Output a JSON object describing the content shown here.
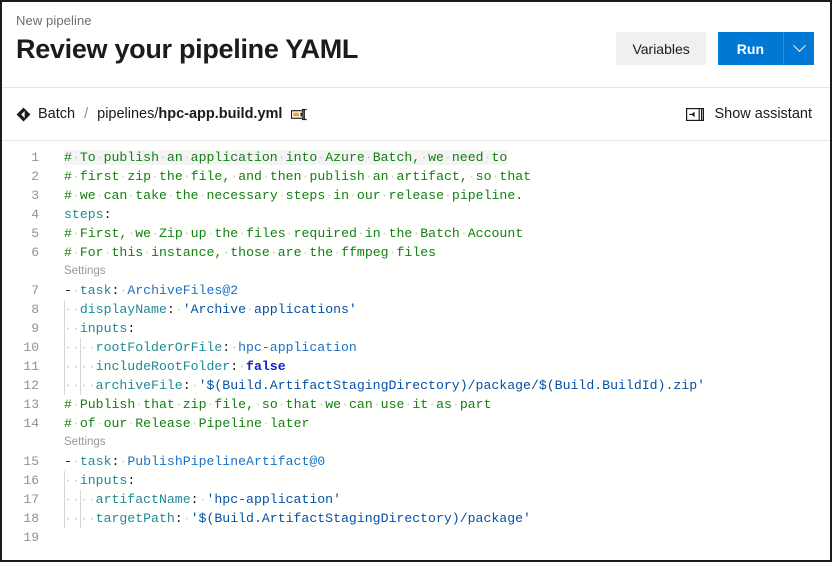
{
  "header": {
    "eyebrow": "New pipeline",
    "title": "Review your pipeline YAML",
    "variables_label": "Variables",
    "run_label": "Run",
    "run_dropdown_icon": "chevron-down-icon"
  },
  "breadcrumb": {
    "repo_icon": "azure-pipelines-diamond-icon",
    "repo_label": "Batch",
    "separator": "/",
    "path_prefix": "pipelines/",
    "path_file": "hpc-app.build.yml",
    "rename_icon": "rename-edit-icon"
  },
  "assistant": {
    "icon": "panel-expand-icon",
    "label": "Show assistant"
  },
  "editor": {
    "accent_color": "#0078d4",
    "comment_color": "#128012",
    "key_color": "#1f8a96",
    "string_color": "#0451a5",
    "boolean_color": "#0f23c6",
    "codelens_color": "#999999",
    "codelens_label": "Settings",
    "lines": [
      {
        "num": "1",
        "current": true,
        "tokens": [
          {
            "t": "comment",
            "v": "#"
          },
          {
            "t": "ws",
            "v": "·"
          },
          {
            "t": "comment",
            "v": "To"
          },
          {
            "t": "ws",
            "v": "·"
          },
          {
            "t": "comment",
            "v": "publish"
          },
          {
            "t": "ws",
            "v": "·"
          },
          {
            "t": "comment",
            "v": "an"
          },
          {
            "t": "ws",
            "v": "·"
          },
          {
            "t": "comment",
            "v": "application"
          },
          {
            "t": "ws",
            "v": "·"
          },
          {
            "t": "comment",
            "v": "into"
          },
          {
            "t": "ws",
            "v": "·"
          },
          {
            "t": "comment",
            "v": "Azure"
          },
          {
            "t": "ws",
            "v": "·"
          },
          {
            "t": "comment",
            "v": "Batch,"
          },
          {
            "t": "ws",
            "v": "·"
          },
          {
            "t": "comment",
            "v": "we"
          },
          {
            "t": "ws",
            "v": "·"
          },
          {
            "t": "comment",
            "v": "need"
          },
          {
            "t": "ws",
            "v": "·"
          },
          {
            "t": "comment",
            "v": "to"
          }
        ]
      },
      {
        "num": "2",
        "tokens": [
          {
            "t": "comment",
            "v": "#"
          },
          {
            "t": "ws",
            "v": "·"
          },
          {
            "t": "comment",
            "v": "first"
          },
          {
            "t": "ws",
            "v": "·"
          },
          {
            "t": "comment",
            "v": "zip"
          },
          {
            "t": "ws",
            "v": "·"
          },
          {
            "t": "comment",
            "v": "the"
          },
          {
            "t": "ws",
            "v": "·"
          },
          {
            "t": "comment",
            "v": "file,"
          },
          {
            "t": "ws",
            "v": "·"
          },
          {
            "t": "comment",
            "v": "and"
          },
          {
            "t": "ws",
            "v": "·"
          },
          {
            "t": "comment",
            "v": "then"
          },
          {
            "t": "ws",
            "v": "·"
          },
          {
            "t": "comment",
            "v": "publish"
          },
          {
            "t": "ws",
            "v": "·"
          },
          {
            "t": "comment",
            "v": "an"
          },
          {
            "t": "ws",
            "v": "·"
          },
          {
            "t": "comment",
            "v": "artifact,"
          },
          {
            "t": "ws",
            "v": "·"
          },
          {
            "t": "comment",
            "v": "so"
          },
          {
            "t": "ws",
            "v": "·"
          },
          {
            "t": "comment",
            "v": "that"
          }
        ]
      },
      {
        "num": "3",
        "tokens": [
          {
            "t": "comment",
            "v": "#"
          },
          {
            "t": "ws",
            "v": "·"
          },
          {
            "t": "comment",
            "v": "we"
          },
          {
            "t": "ws",
            "v": "·"
          },
          {
            "t": "comment",
            "v": "can"
          },
          {
            "t": "ws",
            "v": "·"
          },
          {
            "t": "comment",
            "v": "take"
          },
          {
            "t": "ws",
            "v": "·"
          },
          {
            "t": "comment",
            "v": "the"
          },
          {
            "t": "ws",
            "v": "·"
          },
          {
            "t": "comment",
            "v": "necessary"
          },
          {
            "t": "ws",
            "v": "·"
          },
          {
            "t": "comment",
            "v": "steps"
          },
          {
            "t": "ws",
            "v": "·"
          },
          {
            "t": "comment",
            "v": "in"
          },
          {
            "t": "ws",
            "v": "·"
          },
          {
            "t": "comment",
            "v": "our"
          },
          {
            "t": "ws",
            "v": "·"
          },
          {
            "t": "comment",
            "v": "release"
          },
          {
            "t": "ws",
            "v": "·"
          },
          {
            "t": "comment",
            "v": "pipeline."
          }
        ]
      },
      {
        "num": "4",
        "tokens": [
          {
            "t": "key",
            "v": "steps"
          },
          {
            "t": "plain",
            "v": ":"
          }
        ]
      },
      {
        "num": "5",
        "tokens": [
          {
            "t": "comment",
            "v": "#"
          },
          {
            "t": "ws",
            "v": "·"
          },
          {
            "t": "comment",
            "v": "First,"
          },
          {
            "t": "ws",
            "v": "·"
          },
          {
            "t": "comment",
            "v": "we"
          },
          {
            "t": "ws",
            "v": "·"
          },
          {
            "t": "comment",
            "v": "Zip"
          },
          {
            "t": "ws",
            "v": "·"
          },
          {
            "t": "comment",
            "v": "up"
          },
          {
            "t": "ws",
            "v": "·"
          },
          {
            "t": "comment",
            "v": "the"
          },
          {
            "t": "ws",
            "v": "·"
          },
          {
            "t": "comment",
            "v": "files"
          },
          {
            "t": "ws",
            "v": "·"
          },
          {
            "t": "comment",
            "v": "required"
          },
          {
            "t": "ws",
            "v": "·"
          },
          {
            "t": "comment",
            "v": "in"
          },
          {
            "t": "ws",
            "v": "·"
          },
          {
            "t": "comment",
            "v": "the"
          },
          {
            "t": "ws",
            "v": "·"
          },
          {
            "t": "comment",
            "v": "Batch"
          },
          {
            "t": "ws",
            "v": "·"
          },
          {
            "t": "comment",
            "v": "Account"
          }
        ]
      },
      {
        "num": "6",
        "tokens": [
          {
            "t": "comment",
            "v": "#"
          },
          {
            "t": "ws",
            "v": "·"
          },
          {
            "t": "comment",
            "v": "For"
          },
          {
            "t": "ws",
            "v": "·"
          },
          {
            "t": "comment",
            "v": "this"
          },
          {
            "t": "ws",
            "v": "·"
          },
          {
            "t": "comment",
            "v": "instance,"
          },
          {
            "t": "ws",
            "v": "·"
          },
          {
            "t": "comment",
            "v": "those"
          },
          {
            "t": "ws",
            "v": "·"
          },
          {
            "t": "comment",
            "v": "are"
          },
          {
            "t": "ws",
            "v": "·"
          },
          {
            "t": "comment",
            "v": "the"
          },
          {
            "t": "ws",
            "v": "·"
          },
          {
            "t": "comment",
            "v": "ffmpeg"
          },
          {
            "t": "ws",
            "v": "·"
          },
          {
            "t": "comment",
            "v": "files"
          }
        ]
      },
      {
        "lens": "Settings"
      },
      {
        "num": "7",
        "tokens": [
          {
            "t": "dash",
            "v": "-"
          },
          {
            "t": "ws",
            "v": "·"
          },
          {
            "t": "key",
            "v": "task"
          },
          {
            "t": "plain",
            "v": ":"
          },
          {
            "t": "ws",
            "v": "·"
          },
          {
            "t": "val",
            "v": "ArchiveFiles@2"
          }
        ]
      },
      {
        "num": "8",
        "guides": 1,
        "tokens": [
          {
            "t": "ws",
            "v": "··"
          },
          {
            "t": "key",
            "v": "displayName"
          },
          {
            "t": "plain",
            "v": ":"
          },
          {
            "t": "ws",
            "v": "·"
          },
          {
            "t": "str",
            "v": "'Archive"
          },
          {
            "t": "ws",
            "v": "·"
          },
          {
            "t": "str",
            "v": "applications'"
          }
        ]
      },
      {
        "num": "9",
        "guides": 1,
        "tokens": [
          {
            "t": "ws",
            "v": "··"
          },
          {
            "t": "key",
            "v": "inputs"
          },
          {
            "t": "plain",
            "v": ":"
          }
        ]
      },
      {
        "num": "10",
        "guides": 2,
        "tokens": [
          {
            "t": "ws",
            "v": "··"
          },
          {
            "t": "ws",
            "v": "··"
          },
          {
            "t": "key",
            "v": "rootFolderOrFile"
          },
          {
            "t": "plain",
            "v": ":"
          },
          {
            "t": "ws",
            "v": "·"
          },
          {
            "t": "val",
            "v": "hpc-application"
          }
        ]
      },
      {
        "num": "11",
        "guides": 2,
        "tokens": [
          {
            "t": "ws",
            "v": "··"
          },
          {
            "t": "ws",
            "v": "··"
          },
          {
            "t": "key",
            "v": "includeRootFolder"
          },
          {
            "t": "plain",
            "v": ":"
          },
          {
            "t": "ws",
            "v": "·"
          },
          {
            "t": "bool",
            "v": "false"
          }
        ]
      },
      {
        "num": "12",
        "guides": 2,
        "tokens": [
          {
            "t": "ws",
            "v": "··"
          },
          {
            "t": "ws",
            "v": "··"
          },
          {
            "t": "key",
            "v": "archiveFile"
          },
          {
            "t": "plain",
            "v": ":"
          },
          {
            "t": "ws",
            "v": "·"
          },
          {
            "t": "str",
            "v": "'$(Build.ArtifactStagingDirectory)/package/$(Build.BuildId).zip'"
          }
        ]
      },
      {
        "num": "13",
        "tokens": [
          {
            "t": "comment",
            "v": "#"
          },
          {
            "t": "ws",
            "v": "·"
          },
          {
            "t": "comment",
            "v": "Publish"
          },
          {
            "t": "ws",
            "v": "·"
          },
          {
            "t": "comment",
            "v": "that"
          },
          {
            "t": "ws",
            "v": "·"
          },
          {
            "t": "comment",
            "v": "zip"
          },
          {
            "t": "ws",
            "v": "·"
          },
          {
            "t": "comment",
            "v": "file,"
          },
          {
            "t": "ws",
            "v": "·"
          },
          {
            "t": "comment",
            "v": "so"
          },
          {
            "t": "ws",
            "v": "·"
          },
          {
            "t": "comment",
            "v": "that"
          },
          {
            "t": "ws",
            "v": "·"
          },
          {
            "t": "comment",
            "v": "we"
          },
          {
            "t": "ws",
            "v": "·"
          },
          {
            "t": "comment",
            "v": "can"
          },
          {
            "t": "ws",
            "v": "·"
          },
          {
            "t": "comment",
            "v": "use"
          },
          {
            "t": "ws",
            "v": "·"
          },
          {
            "t": "comment",
            "v": "it"
          },
          {
            "t": "ws",
            "v": "·"
          },
          {
            "t": "comment",
            "v": "as"
          },
          {
            "t": "ws",
            "v": "·"
          },
          {
            "t": "comment",
            "v": "part"
          }
        ]
      },
      {
        "num": "14",
        "tokens": [
          {
            "t": "comment",
            "v": "#"
          },
          {
            "t": "ws",
            "v": "·"
          },
          {
            "t": "comment",
            "v": "of"
          },
          {
            "t": "ws",
            "v": "·"
          },
          {
            "t": "comment",
            "v": "our"
          },
          {
            "t": "ws",
            "v": "·"
          },
          {
            "t": "comment",
            "v": "Release"
          },
          {
            "t": "ws",
            "v": "·"
          },
          {
            "t": "comment",
            "v": "Pipeline"
          },
          {
            "t": "ws",
            "v": "·"
          },
          {
            "t": "comment",
            "v": "later"
          }
        ]
      },
      {
        "lens": "Settings"
      },
      {
        "num": "15",
        "tokens": [
          {
            "t": "dash",
            "v": "-"
          },
          {
            "t": "ws",
            "v": "·"
          },
          {
            "t": "key",
            "v": "task"
          },
          {
            "t": "plain",
            "v": ":"
          },
          {
            "t": "ws",
            "v": "·"
          },
          {
            "t": "val",
            "v": "PublishPipelineArtifact@0"
          }
        ]
      },
      {
        "num": "16",
        "guides": 1,
        "tokens": [
          {
            "t": "ws",
            "v": "··"
          },
          {
            "t": "key",
            "v": "inputs"
          },
          {
            "t": "plain",
            "v": ":"
          }
        ]
      },
      {
        "num": "17",
        "guides": 2,
        "tokens": [
          {
            "t": "ws",
            "v": "··"
          },
          {
            "t": "ws",
            "v": "··"
          },
          {
            "t": "key",
            "v": "artifactName"
          },
          {
            "t": "plain",
            "v": ":"
          },
          {
            "t": "ws",
            "v": "·"
          },
          {
            "t": "str",
            "v": "'hpc-application'"
          }
        ]
      },
      {
        "num": "18",
        "guides": 2,
        "tokens": [
          {
            "t": "ws",
            "v": "··"
          },
          {
            "t": "ws",
            "v": "··"
          },
          {
            "t": "key",
            "v": "targetPath"
          },
          {
            "t": "plain",
            "v": ":"
          },
          {
            "t": "ws",
            "v": "·"
          },
          {
            "t": "str",
            "v": "'$(Build.ArtifactStagingDirectory)/package'"
          }
        ]
      },
      {
        "num": "19",
        "tokens": []
      }
    ]
  }
}
